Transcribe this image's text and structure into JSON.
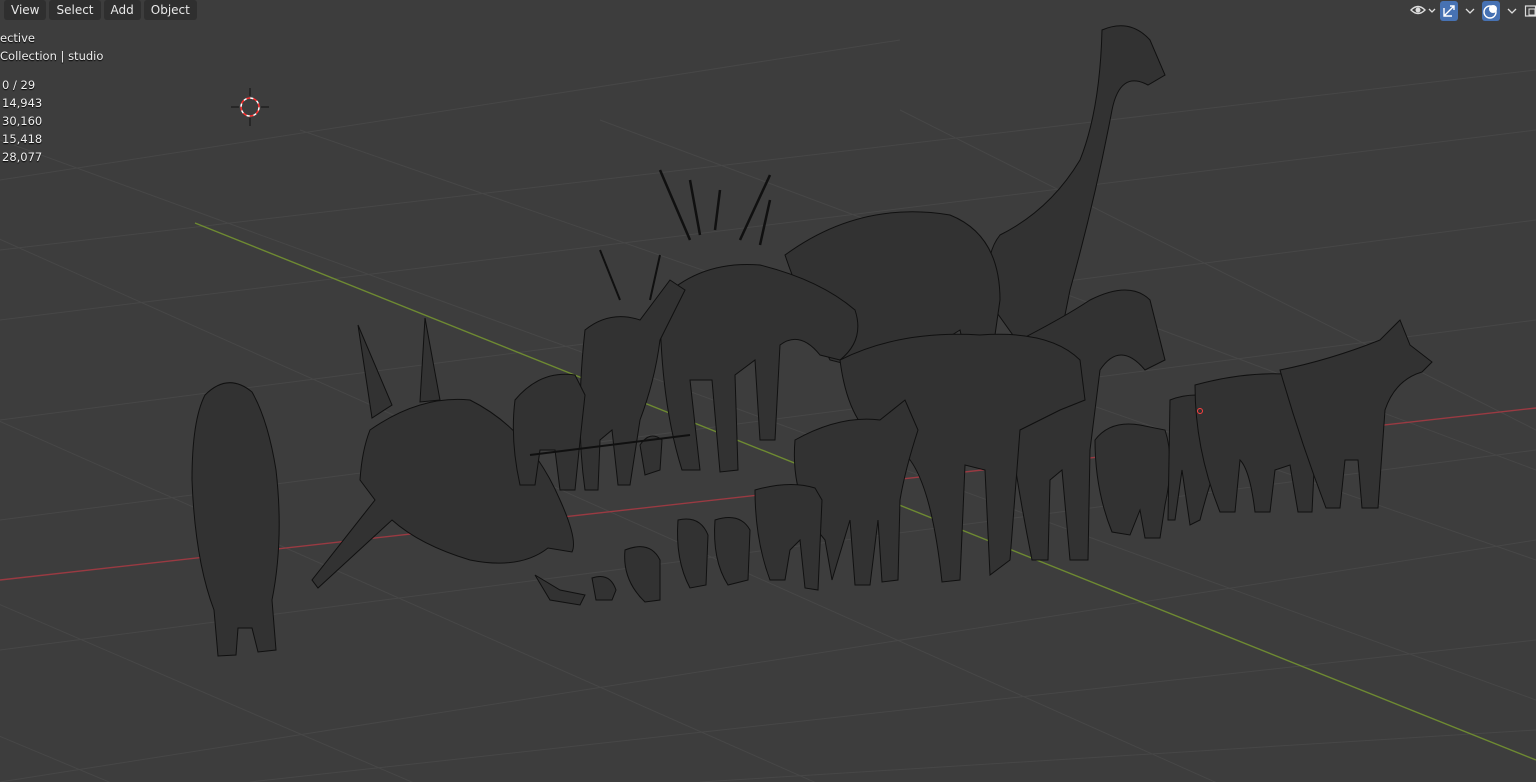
{
  "header": {
    "menus": [
      "View",
      "Select",
      "Add",
      "Object"
    ]
  },
  "overlay": {
    "view_name": "ective",
    "collection": "Collection | studio",
    "stats": [
      "0 / 29",
      "14,943",
      "30,160",
      "15,418",
      "28,077"
    ]
  },
  "toolbar_icons": [
    "visibility-eye-icon",
    "gizmo-icon",
    "overlay-icon"
  ],
  "colors": {
    "background": "#3d3d3d",
    "grid": "#474747",
    "x_axis": "#9a3a42",
    "y_axis": "#6e8a32",
    "wire": "#111111",
    "cursor_red": "#ff3030",
    "accent_blue": "#4772b3"
  }
}
